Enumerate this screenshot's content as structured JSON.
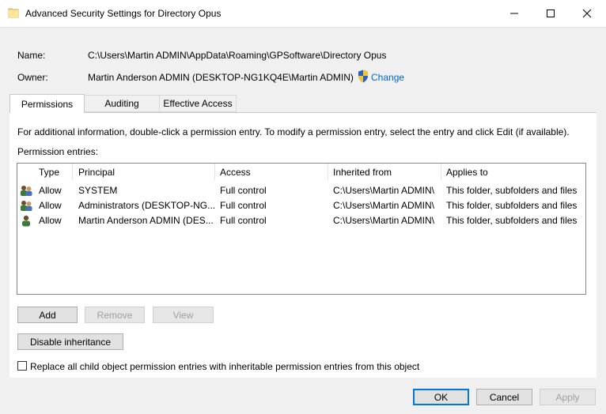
{
  "window": {
    "title": "Advanced Security Settings for Directory Opus",
    "icon": "folder-icon"
  },
  "details": {
    "name_label": "Name:",
    "name_value": "C:\\Users\\Martin ADMIN\\AppData\\Roaming\\GPSoftware\\Directory Opus",
    "owner_label": "Owner:",
    "owner_value": "Martin Anderson ADMIN (DESKTOP-NG1KQ4E\\Martin ADMIN)",
    "change_label": "Change"
  },
  "tabs": [
    {
      "label": "Permissions",
      "selected": true
    },
    {
      "label": "Auditing",
      "selected": false
    },
    {
      "label": "Effective Access",
      "selected": false
    }
  ],
  "permissions": {
    "info_text": "For additional information, double-click a permission entry. To modify a permission entry, select the entry and click Edit (if available).",
    "entries_label": "Permission entries:",
    "columns": [
      "Type",
      "Principal",
      "Access",
      "Inherited from",
      "Applies to"
    ],
    "rows": [
      {
        "icon": "group-users-icon",
        "type": "Allow",
        "principal": "SYSTEM",
        "access": "Full control",
        "inherited_from": "C:\\Users\\Martin ADMIN\\",
        "applies_to": "This folder, subfolders and files"
      },
      {
        "icon": "group-users-icon",
        "type": "Allow",
        "principal": "Administrators (DESKTOP-NG...",
        "access": "Full control",
        "inherited_from": "C:\\Users\\Martin ADMIN\\",
        "applies_to": "This folder, subfolders and files"
      },
      {
        "icon": "single-user-icon",
        "type": "Allow",
        "principal": "Martin Anderson ADMIN (DES...",
        "access": "Full control",
        "inherited_from": "C:\\Users\\Martin ADMIN\\",
        "applies_to": "This folder, subfolders and files"
      }
    ]
  },
  "buttons": {
    "add": "Add",
    "remove": "Remove",
    "view": "View",
    "disable_inheritance": "Disable inheritance",
    "ok": "OK",
    "cancel": "Cancel",
    "apply": "Apply"
  },
  "replace_checkbox": {
    "label": "Replace all child object permission entries with inheritable permission entries from this object",
    "checked": false
  },
  "colors": {
    "link": "#0066cc",
    "default_button_border": "#0078d7"
  }
}
